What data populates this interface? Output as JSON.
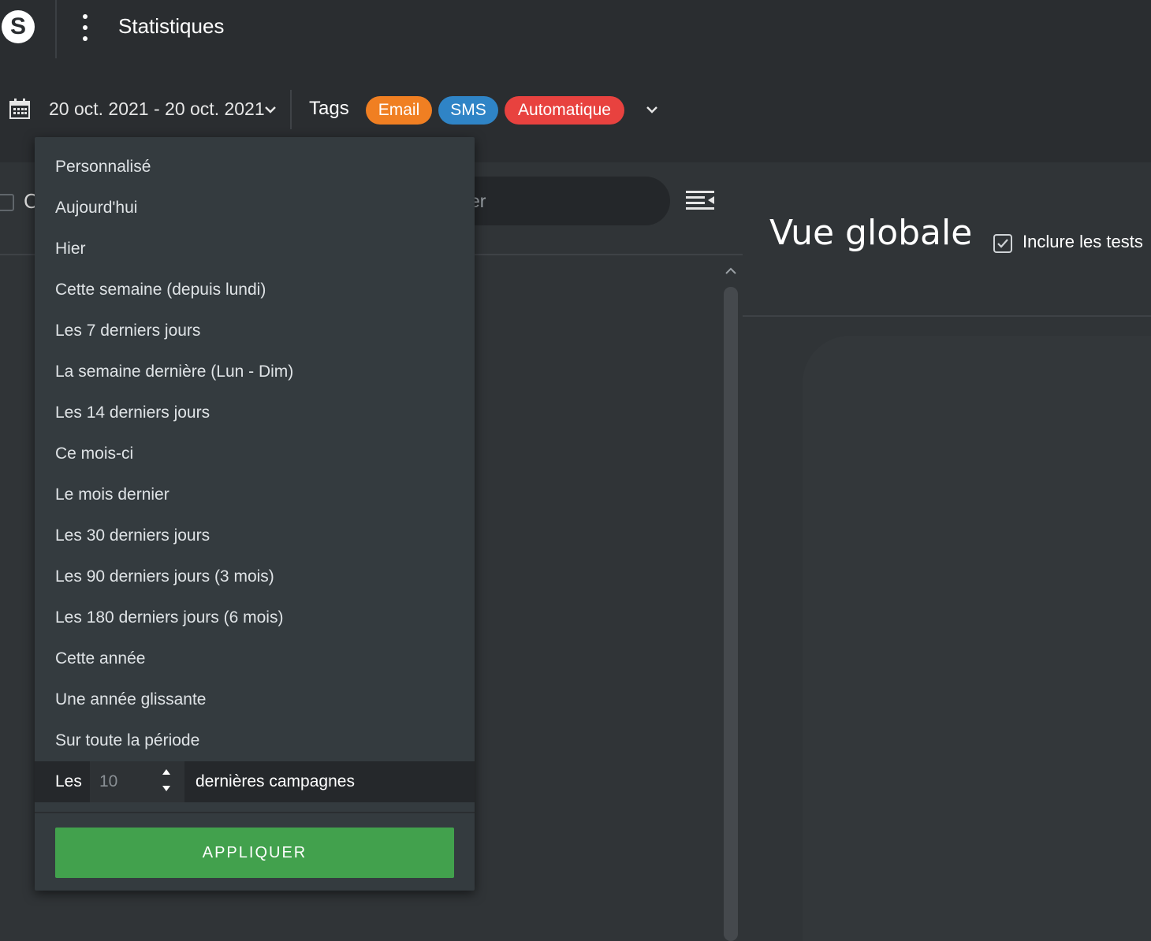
{
  "header": {
    "logo_letter": "S",
    "title": "Statistiques"
  },
  "filters": {
    "date_range": "20 oct. 2021 - 20 oct. 2021",
    "tags_label": "Tags",
    "tags": [
      {
        "label": "Email",
        "color": "#f07f22"
      },
      {
        "label": "SMS",
        "color": "#2f84c6"
      },
      {
        "label": "Automatique",
        "color": "#e8423f"
      }
    ]
  },
  "left_panel": {
    "partial_label": "C",
    "search_fragment": "er"
  },
  "right_panel": {
    "title": "Vue globale",
    "include_tests_label": "Inclure les tests",
    "include_tests_checked": true
  },
  "date_menu": {
    "items": [
      "Personnalisé",
      "Aujourd'hui",
      "Hier",
      "Cette semaine (depuis lundi)",
      "Les 7 derniers jours",
      "La semaine dernière (Lun - Dim)",
      "Les 14 derniers jours",
      "Ce mois-ci",
      "Le mois dernier",
      "Les 30 derniers jours",
      "Les 90 derniers jours (3 mois)",
      "Les 180 derniers jours (6 mois)",
      "Cette année",
      "Une année glissante",
      "Sur toute la période"
    ],
    "last_campaigns": {
      "prefix": "Les",
      "value": "10",
      "suffix": "dernières campagnes"
    },
    "apply_label": "APPLIQUER"
  }
}
